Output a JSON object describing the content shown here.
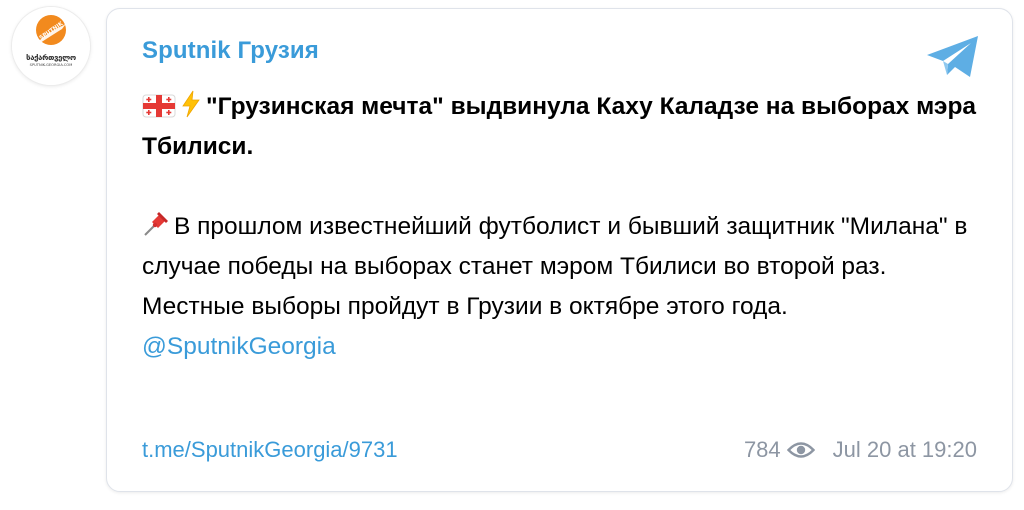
{
  "channel": {
    "name": "Sputnik Грузия",
    "avatar": {
      "brand": "SPUTNIK",
      "title": "საქართველო",
      "subtitle": "SPUTNIK-GEORGIA.COM",
      "accent_color": "#f28a1e"
    }
  },
  "post": {
    "headline_icons": [
      "georgia-flag-icon",
      "lightning-icon"
    ],
    "headline": "\"Грузинская мечта\" выдвинула Каху Каладзе на выборах мэра Тбилиси.",
    "body_icon": "pushpin-icon",
    "body": "В прошлом известнейший футболист и бывший защитник \"Милана\" в случае победы на выборах станет мэром Тбилиси во второй раз. Местные выборы пройдут в Грузии в октябре этого года.",
    "mention": "@SputnikGeorgia"
  },
  "footer": {
    "link": "t.me/SputnikGeorgia/9731",
    "views": "784",
    "timestamp": "Jul 20 at 19:20"
  },
  "colors": {
    "link": "#3a9bd9",
    "meta": "#8d96a3",
    "telegram": "#5eaee4"
  }
}
